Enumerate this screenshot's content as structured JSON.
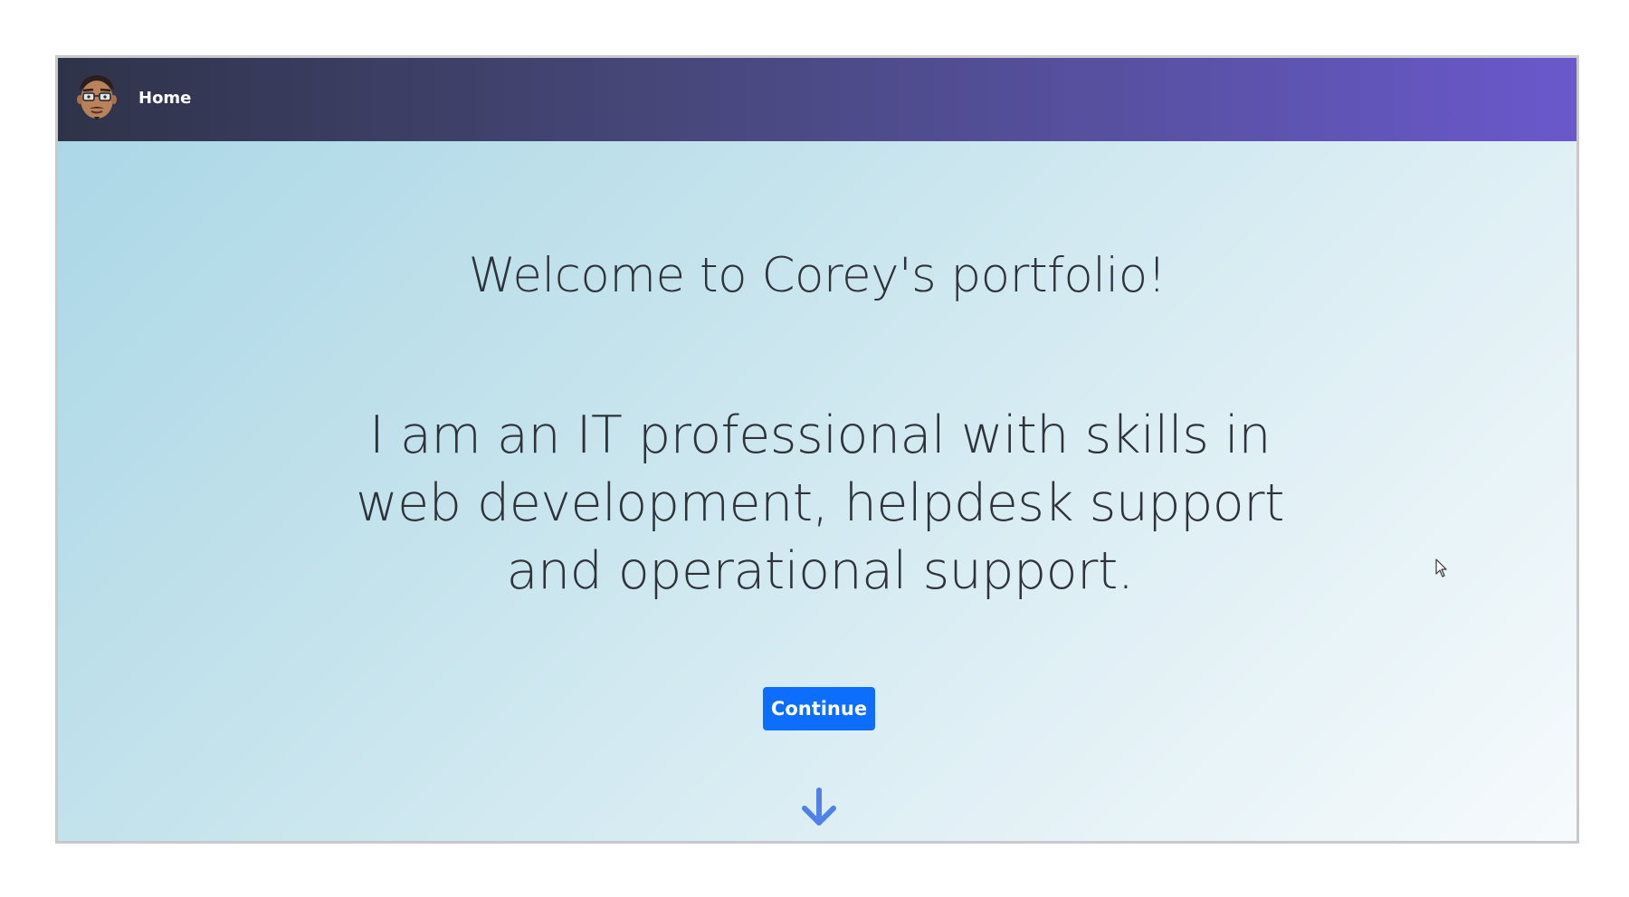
{
  "nav": {
    "home_label": "Home",
    "avatar_icon": "avatar-icon"
  },
  "hero": {
    "headline": "Welcome to Corey's portfolio!",
    "tagline": "I am an IT professional with skills in web development, helpdesk support and operational support.",
    "continue_label": "Continue",
    "scroll_icon": "arrow-down-icon"
  },
  "colors": {
    "navbar_start": "#2f3349",
    "navbar_end": "#6a58cc",
    "button": "#0d6efd",
    "arrow": "#4f82e6",
    "text": "#2f3339"
  }
}
